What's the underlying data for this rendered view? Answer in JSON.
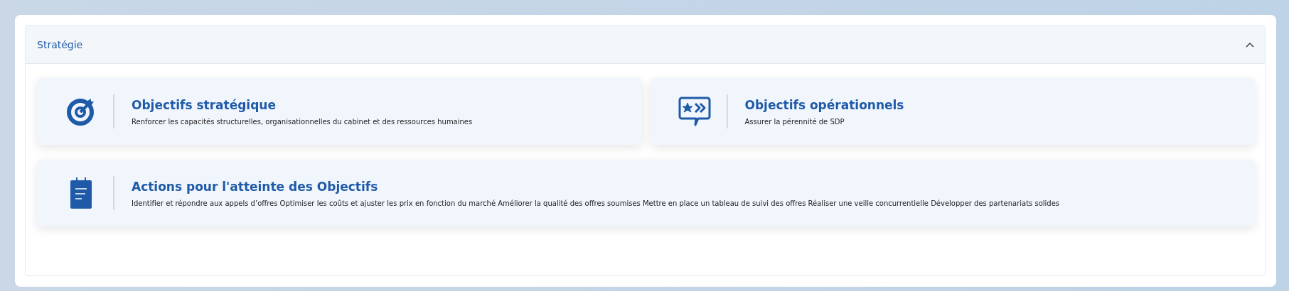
{
  "section": {
    "title": "Stratégie",
    "expanded": true
  },
  "cards": [
    {
      "title": "Objectifs stratégique",
      "description": "Renforcer les capacités structurelles, organisationnelles du cabinet et des ressources humaines"
    },
    {
      "title": "Objectifs opérationnels",
      "description": "Assurer la pérennité de SDP"
    },
    {
      "title": "Actions pour l'atteinte des Objectifs",
      "description": "Identifier et répondre aux appels d’offres Optimiser les coûts et ajuster les prix en fonction du marché Améliorer la qualité des offres soumises Mettre en place un tableau de suivi des offres Réaliser une veille concurrentielle Développer des partenariats solides"
    }
  ]
}
